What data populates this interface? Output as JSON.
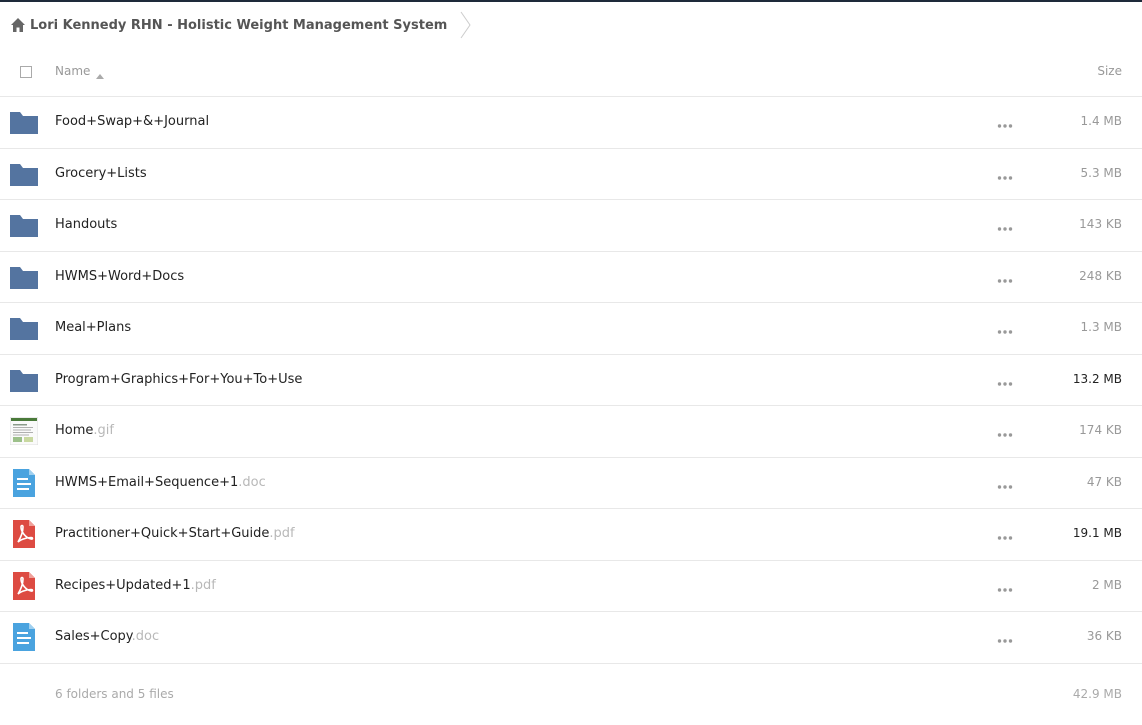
{
  "breadcrumb": {
    "label": "Lori Kennedy RHN - Holistic Weight Management System"
  },
  "header": {
    "name_label": "Name",
    "size_label": "Size"
  },
  "items": [
    {
      "name": "Food+Swap+&+Journal",
      "ext": "",
      "type": "folder",
      "size": "1.4 MB",
      "dark": false
    },
    {
      "name": "Grocery+Lists",
      "ext": "",
      "type": "folder",
      "size": "5.3 MB",
      "dark": false
    },
    {
      "name": "Handouts",
      "ext": "",
      "type": "folder",
      "size": "143 KB",
      "dark": false
    },
    {
      "name": "HWMS+Word+Docs",
      "ext": "",
      "type": "folder",
      "size": "248 KB",
      "dark": false
    },
    {
      "name": "Meal+Plans",
      "ext": "",
      "type": "folder",
      "size": "1.3 MB",
      "dark": false
    },
    {
      "name": "Program+Graphics+For+You+To+Use",
      "ext": "",
      "type": "folder",
      "size": "13.2 MB",
      "dark": true
    },
    {
      "name": "Home",
      "ext": ".gif",
      "type": "image",
      "size": "174 KB",
      "dark": false
    },
    {
      "name": "HWMS+Email+Sequence+1",
      "ext": ".doc",
      "type": "doc",
      "size": "47 KB",
      "dark": false
    },
    {
      "name": "Practitioner+Quick+Start+Guide",
      "ext": ".pdf",
      "type": "pdf",
      "size": "19.1 MB",
      "dark": true
    },
    {
      "name": "Recipes+Updated+1",
      "ext": ".pdf",
      "type": "pdf",
      "size": "2 MB",
      "dark": false
    },
    {
      "name": "Sales+Copy",
      "ext": ".doc",
      "type": "doc",
      "size": "36 KB",
      "dark": false
    }
  ],
  "footer": {
    "summary": "6 folders and 5 files",
    "total": "42.9 MB"
  },
  "colors": {
    "folder": "#5474a0",
    "pdf": "#dd4b42",
    "doc": "#4aa3df"
  },
  "icons": {
    "folder": "folder-icon",
    "image": "image-thumbnail-icon",
    "doc": "document-icon",
    "pdf": "pdf-icon",
    "more": "more-options-icon"
  }
}
